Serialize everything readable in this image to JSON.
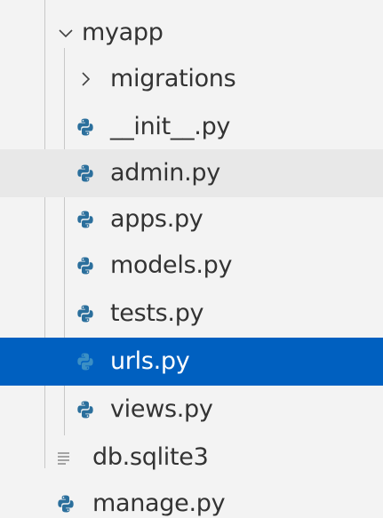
{
  "explorer": {
    "items": [
      {
        "label": "myapp",
        "type": "folder",
        "expanded": true,
        "icon": "chevron-down-icon"
      },
      {
        "label": "migrations",
        "type": "folder",
        "expanded": false,
        "icon": "chevron-right-icon"
      },
      {
        "label": "__init__.py",
        "type": "python-file",
        "icon": "python-icon"
      },
      {
        "label": "admin.py",
        "type": "python-file",
        "icon": "python-icon",
        "state": "hover"
      },
      {
        "label": "apps.py",
        "type": "python-file",
        "icon": "python-icon"
      },
      {
        "label": "models.py",
        "type": "python-file",
        "icon": "python-icon"
      },
      {
        "label": "tests.py",
        "type": "python-file",
        "icon": "python-icon"
      },
      {
        "label": "urls.py",
        "type": "python-file",
        "icon": "python-icon",
        "state": "selected"
      },
      {
        "label": "views.py",
        "type": "python-file",
        "icon": "python-icon"
      },
      {
        "label": "db.sqlite3",
        "type": "file",
        "icon": "file-lines-icon"
      },
      {
        "label": "manage.py",
        "type": "python-file",
        "icon": "python-icon"
      }
    ]
  },
  "colors": {
    "background": "#f3f3f3",
    "hover": "#e8e8e8",
    "selected": "#0060c0",
    "text": "#333333",
    "python_icon": "#2b6f9c",
    "indent_guide": "#c8c8c8"
  }
}
